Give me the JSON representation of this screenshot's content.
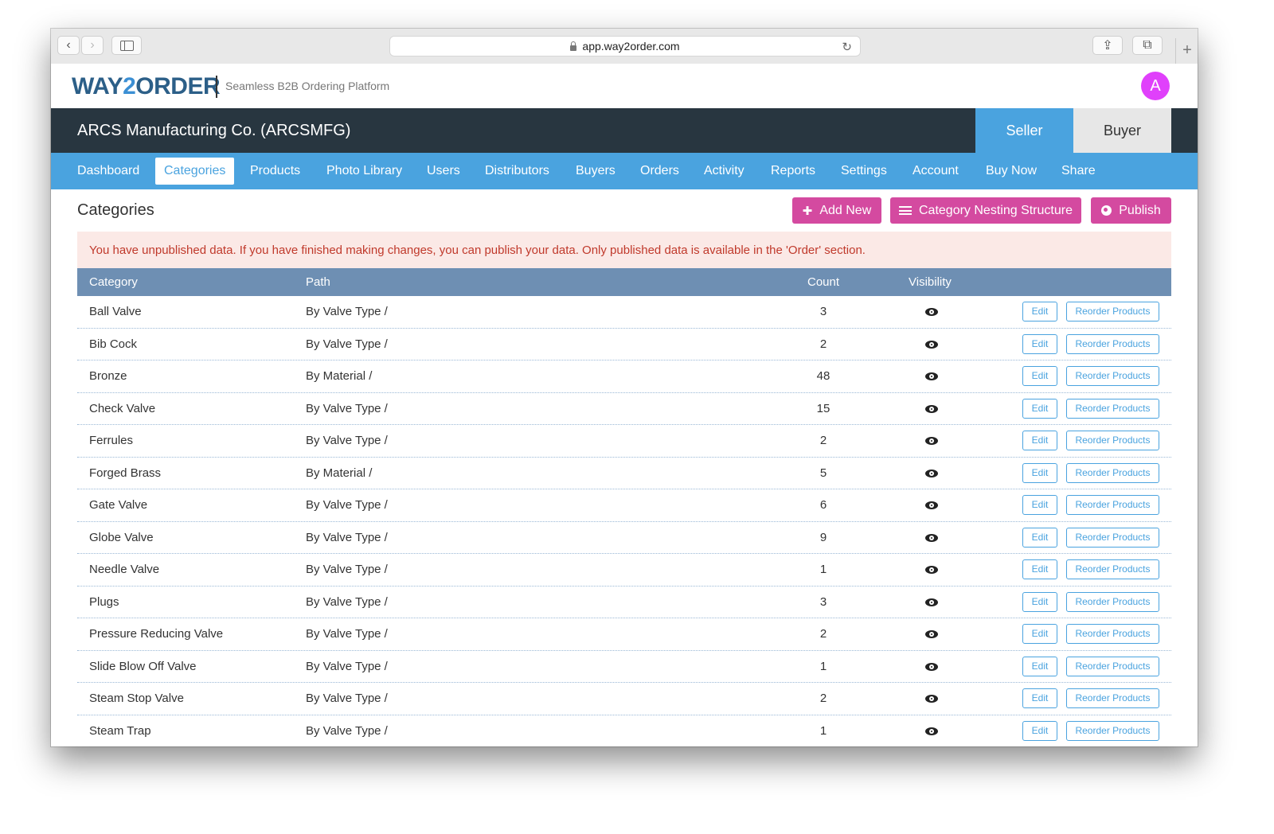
{
  "browser": {
    "url": "app.way2order.com"
  },
  "app": {
    "logo_way": "WAY",
    "logo_two": "2",
    "logo_order": "ORDER",
    "tagline": "Seamless B2B Ordering Platform",
    "avatar_letter": "A"
  },
  "company": {
    "name": "ARCS Manufacturing Co. (ARCSMFG)"
  },
  "roles": {
    "seller": "Seller",
    "buyer": "Buyer"
  },
  "nav": [
    "Dashboard",
    "Categories",
    "Products",
    "Photo Library",
    "Users",
    "Distributors",
    "Buyers",
    "Orders",
    "Activity",
    "Reports",
    "Settings",
    "Account",
    "Buy Now",
    "Share"
  ],
  "page": {
    "title": "Categories",
    "add_new": "Add New",
    "nesting": "Category Nesting Structure",
    "publish": "Publish",
    "alert": "You have unpublished data. If you have finished making changes, you can publish your data. Only published data is available in the 'Order' section."
  },
  "table": {
    "headers": {
      "category": "Category",
      "path": "Path",
      "count": "Count",
      "visibility": "Visibility"
    },
    "edit_label": "Edit",
    "reorder_label": "Reorder Products",
    "rows": [
      {
        "category": "Ball Valve",
        "path": "By Valve Type /",
        "count": "3"
      },
      {
        "category": "Bib Cock",
        "path": "By Valve Type /",
        "count": "2"
      },
      {
        "category": "Bronze",
        "path": "By Material /",
        "count": "48"
      },
      {
        "category": "Check Valve",
        "path": "By Valve Type /",
        "count": "15"
      },
      {
        "category": "Ferrules",
        "path": "By Valve Type /",
        "count": "2"
      },
      {
        "category": "Forged Brass",
        "path": "By Material /",
        "count": "5"
      },
      {
        "category": "Gate Valve",
        "path": "By Valve Type /",
        "count": "6"
      },
      {
        "category": "Globe Valve",
        "path": "By Valve Type /",
        "count": "9"
      },
      {
        "category": "Needle Valve",
        "path": "By Valve Type /",
        "count": "1"
      },
      {
        "category": "Plugs",
        "path": "By Valve Type /",
        "count": "3"
      },
      {
        "category": "Pressure Reducing Valve",
        "path": "By Valve Type /",
        "count": "2"
      },
      {
        "category": "Slide Blow Off Valve",
        "path": "By Valve Type /",
        "count": "1"
      },
      {
        "category": "Steam Stop Valve",
        "path": "By Valve Type /",
        "count": "2"
      },
      {
        "category": "Steam Trap",
        "path": "By Valve Type /",
        "count": "1"
      }
    ]
  }
}
